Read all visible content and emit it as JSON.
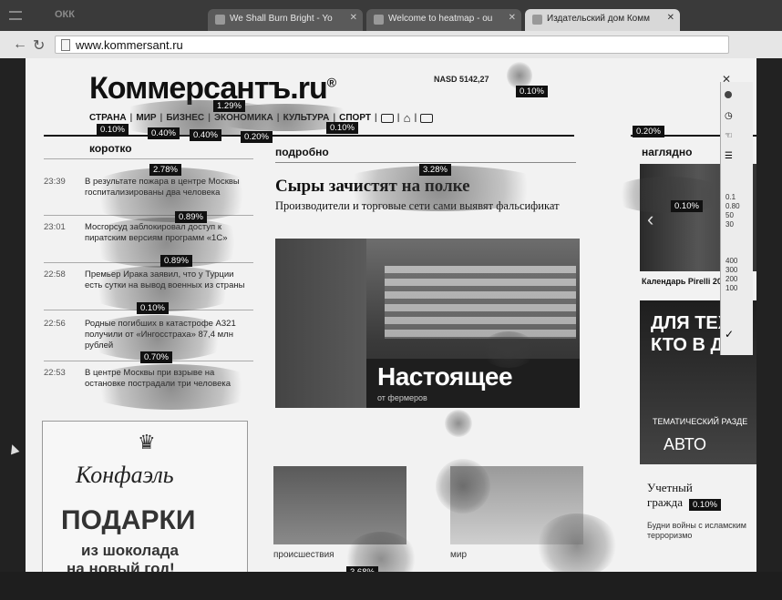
{
  "browser": {
    "brand": "ОКК",
    "tabs": [
      {
        "label": "We Shall Burn Bright - Yo",
        "active": false
      },
      {
        "label": "Welcome to heatmap - ou",
        "active": false
      },
      {
        "label": "Издательский дом Комм",
        "active": true
      }
    ],
    "url": "www.kommersant.ru"
  },
  "page": {
    "logo": "Коммерсантъ.ru",
    "logo_mark": "®",
    "ticker": "NASD 5142,27",
    "nav": [
      "СТРАНА",
      "МИР",
      "БИЗНЕС",
      "ЭКОНОМИКА",
      "КУЛЬТУРА",
      "СПОРТ"
    ],
    "columns": {
      "left": "коротко",
      "center": "подробно",
      "right": "наглядно"
    },
    "news": [
      {
        "time": "23:39",
        "text": "В результате пожара в центре Москвы госпитализированы два человека"
      },
      {
        "time": "23:01",
        "text": "Мосгорсуд заблокировал доступ к пиратским версиям программ «1С»"
      },
      {
        "time": "22:58",
        "text": "Премьер Ирака заявил, что у Турции есть сутки на вывод военных из страны"
      },
      {
        "time": "22:56",
        "text": "Родные погибших в катастрофе A321 получили от «Ингосстраха» 87,4 млн рублей"
      },
      {
        "time": "22:53",
        "text": "В центре Москвы при взрыве на остановке пострадали три человека"
      }
    ],
    "headline": "Сыры зачистят на полке",
    "subhead": "Производители и торговые сети сами выявят фальсификат",
    "photo_caption": "Настоящее",
    "photo_small_text": "от фермеров",
    "thumbs": [
      {
        "label": "происшествия"
      },
      {
        "label": "мир"
      }
    ],
    "right": {
      "calendar_label": "Календарь Pirelli 2016",
      "ad_line1": "ДЛЯ ТЕХ,",
      "ad_line2": "КТО В ДВИ",
      "ad_sub": "ТЕМАТИЧЕСКИЙ РАЗДЕ",
      "ad_auto": "АВТО",
      "story_title_1": "Учетный",
      "story_title_2": "гражда",
      "story_sub": "Будни войны с исламским терроризмо"
    },
    "ad": {
      "brand": "Конфаэль",
      "big": "ПОДАРКИ",
      "line1": "из шоколада",
      "line2": "на новый год!"
    },
    "side_panel": {
      "values": [
        "0.1",
        "0.80",
        "50",
        "30",
        "400",
        "300",
        "200",
        "100"
      ]
    }
  },
  "heatmap": {
    "badges": [
      "0.10%",
      "1.29%",
      "0.10%",
      "0.40%",
      "0.40%",
      "0.20%",
      "0.10%",
      "0.20%",
      "2.78%",
      "3.28%",
      "0.89%",
      "0.10%",
      "0.89%",
      "0.10%",
      "0.70%",
      "0.10%",
      "3.68%"
    ]
  }
}
